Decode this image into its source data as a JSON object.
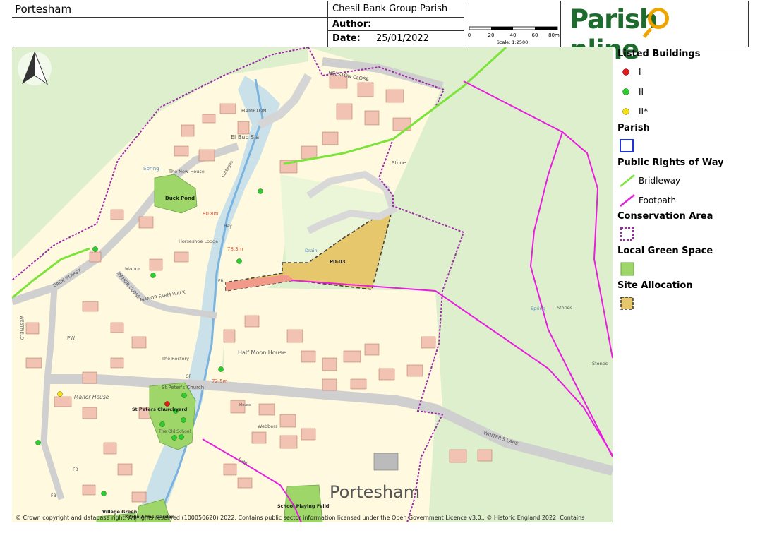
{
  "header": {
    "place": "Portesham",
    "parish": "Chesil Bank Group Parish",
    "author_label": "Author:",
    "author_value": "",
    "date_label": "Date:",
    "date_value": "25/01/2022",
    "scale_ticks": [
      "0",
      "20",
      "40",
      "60",
      "80m"
    ],
    "scale_text": "Scale: 1:2500",
    "logo_left": "Parish",
    "logo_right": "nline"
  },
  "legend": {
    "listed_buildings": "Listed Buildings",
    "grade_i": "I",
    "grade_ii": "II",
    "grade_ii_star": "II*",
    "parish": "Parish",
    "prow": "Public Rights of Way",
    "bridleway": "Bridleway",
    "footpath": "Footpath",
    "conservation": "Conservation Area",
    "green_space": "Local Green Space",
    "site_allocation": "Site Allocation",
    "colors": {
      "grade_i": "#e21b1b",
      "grade_ii": "#2ecc2e",
      "grade_ii_star": "#f3e10f",
      "parish": "#1f35d8",
      "bridleway": "#7be33a",
      "footpath": "#e81de0",
      "conservation": "#9b2aa5",
      "green_space": "#9fd66a",
      "site_allocation": "#e6c76b"
    }
  },
  "map": {
    "labels": {
      "helston_close": "HELSTON CLOSE",
      "hampton": "HAMPTON",
      "el_bub_sia": "El Bub Sia",
      "spring1": "Spring",
      "the_new_house": "The New House",
      "cottages": "Cottages",
      "stone1": "Stone",
      "duck_pond": "Duck Pond",
      "elev1": "80.8m",
      "hay": "Hay",
      "horseshoe_lodge": "Horseshoe Lodge",
      "elev2": "78.3m",
      "drain": "Drain",
      "p003": "P0-03",
      "manor": "Manor",
      "manor_close": "MANOR CLOSE",
      "manor_farm_walk": "MANOR FARM WALK",
      "back_street": "BACK STREET",
      "westfield": "WESTFIELD",
      "fb1": "FB",
      "pw": "PW",
      "half_moon_house": "Half Moon House",
      "the_rectory": "The Rectory",
      "spring2": "Spring",
      "stones1": "Stones",
      "stones2": "Stones",
      "st_peters_church": "St Peter's Church",
      "gp": "GP",
      "elev3": "72.5m",
      "st_peters_churchyard": "St Peters Churchyard",
      "manor_house": "Manor House",
      "the_old_school": "The Old School",
      "house": "House",
      "webbers": "Webbers",
      "winters_lane": "WINTER'S LANE",
      "path": "Path",
      "fb2": "FB",
      "fb3": "FB",
      "portesham": "Portesham",
      "village_green": "Village Green",
      "kings_arms_garden": "Kings Arms Garden",
      "school_playing_field": "School Playing Feild"
    }
  },
  "copyright": "© Crown copyright and database right. All rights reserved (100050620) 2022. Contains public sector information licensed under the Open Government Licence v3.0., © Historic England 2022. Contains"
}
